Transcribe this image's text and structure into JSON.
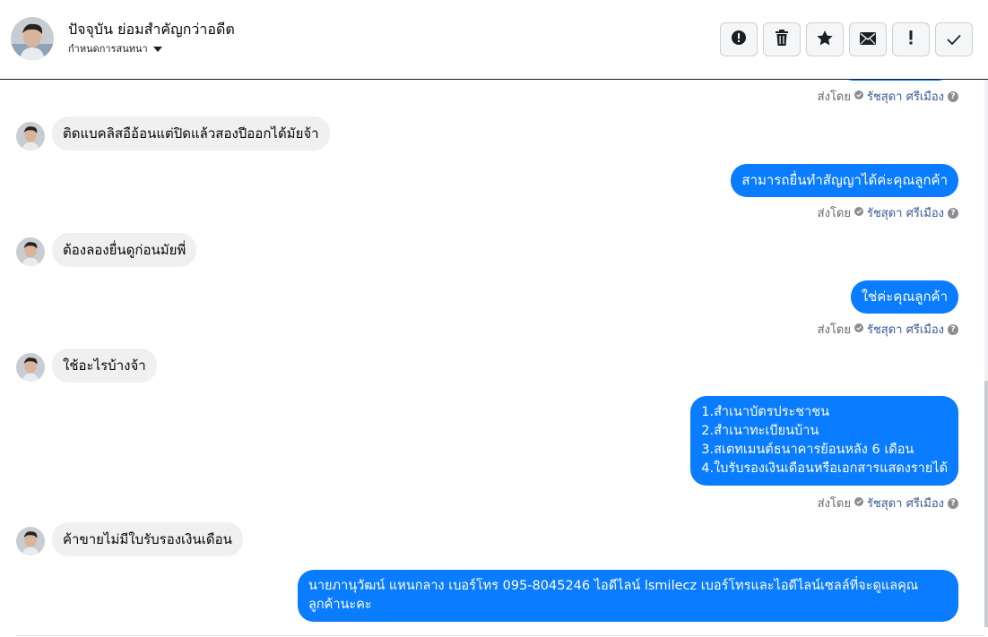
{
  "header": {
    "title": "ปัจจุบัน ย่อมสำคัญกว่าอดีต",
    "subtitle": "กำหนดการสนทนา",
    "toolbar": {
      "spam_icon": "alert-circle-icon",
      "delete_icon": "trash-icon",
      "star_icon": "star-icon",
      "mail_icon": "envelope-icon",
      "important_icon": "exclamation-icon",
      "done_icon": "check-icon"
    }
  },
  "colors": {
    "outgoing_bubble": "#0a7cff",
    "incoming_bubble": "#f0f0f0"
  },
  "messages": [
    {
      "from": "page",
      "sent_label": "ส่งโดย",
      "agent": "รัชสุดา ศรีเมือง",
      "text": ""
    },
    {
      "from": "user",
      "text": "ติดแบคลิสอือ้อนแต่ปิดแล้วสองปีออกได้มัยจ้า"
    },
    {
      "from": "page",
      "text": "สามารถยื่นทำสัญญาได้ค่ะคุณลูกค้า",
      "sent_label": "ส่งโดย",
      "agent": "รัชสุดา ศรีเมือง"
    },
    {
      "from": "user",
      "text": "ต้องลองยื่นดูก่อนมัยพี่"
    },
    {
      "from": "page",
      "text": "ใช่ค่ะคุณลูกค้า",
      "sent_label": "ส่งโดย",
      "agent": "รัชสุดา ศรีเมือง"
    },
    {
      "from": "user",
      "text": "ใช้อะไรบ้างจ้า"
    },
    {
      "from": "page",
      "text": "1.สำเนาบัตรประชาชน\n2.สำเนาทะเบียนบ้าน\n3.สเตทเมนต์ธนาคารย้อนหลัง 6 เดือน\n4.ใบรับรองเงินเดือนหรือเอกสารแสดงรายได้",
      "sent_label": "ส่งโดย",
      "agent": "รัชสุดา ศรีเมือง"
    },
    {
      "from": "user",
      "text": "ค้าขายไม่มีใบรับรองเงินเดือน"
    },
    {
      "from": "page",
      "text": "นายภานุวัฒน์ แหนกลาง เบอร์โทร 095-8045246 ไอดีไลน์ lsmilecz  เบอร์โทรและไอดีไลน์เซลล์ที่จะดูแลคุณ\nลูกค้านะคะ"
    }
  ]
}
